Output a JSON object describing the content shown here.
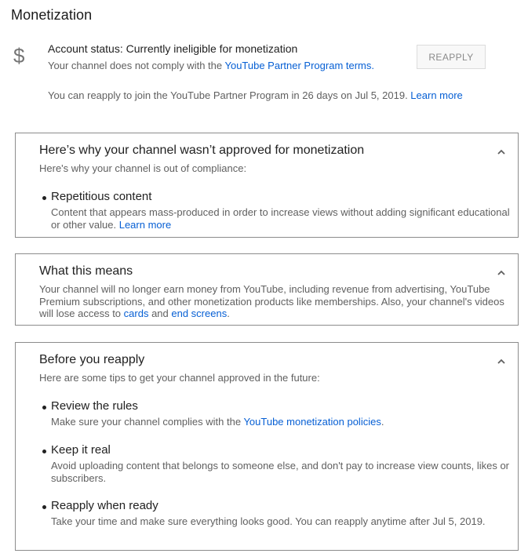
{
  "page": {
    "title": "Monetization"
  },
  "status": {
    "icon": "dollar-icon",
    "icon_glyph": "$",
    "title": "Account status: Currently ineligible for monetization",
    "desc_prefix": "Your channel does not comply with the ",
    "desc_link": "YouTube Partner Program terms.",
    "reapply_button": "REAPPLY",
    "note_prefix": "You can reapply to join the YouTube Partner Program in 26 days on Jul 5, 2019. ",
    "note_link": "Learn more"
  },
  "cards": {
    "why": {
      "title": "Here’s why your channel wasn’t approved for monetization",
      "subtitle": "Here's why your channel is out of compliance:",
      "items": [
        {
          "title": "Repetitious content",
          "desc": "Content that appears mass-produced in order to increase views without adding significant educational or other value. ",
          "link": "Learn more"
        }
      ]
    },
    "means": {
      "title": "What this means",
      "text_prefix": "Your channel will no longer earn money from YouTube, including revenue from advertising, YouTube Premium subscriptions, and other monetization products like memberships. Also, your channel's videos will lose access to ",
      "link_cards": "cards",
      "text_and": " and ",
      "link_end_screens": "end screens",
      "text_suffix": "."
    },
    "before": {
      "title": "Before you reapply",
      "subtitle": "Here are some tips to get your channel approved in the future:",
      "items": [
        {
          "title": "Review the rules",
          "desc_prefix": "Make sure your channel complies with the ",
          "link": "YouTube monetization policies",
          "desc_suffix": "."
        },
        {
          "title": "Keep it real",
          "desc": "Avoid uploading content that belongs to someone else, and don't pay to increase view counts, likes or subscribers."
        },
        {
          "title": "Reapply when ready",
          "desc": "Take your time and make sure everything looks good. You can reapply anytime after Jul 5, 2019."
        }
      ]
    }
  },
  "icons": {
    "collapse": "chevron-up-icon",
    "bullet": "bullet-dot"
  },
  "colors": {
    "link": "#065fd4",
    "secondary_text": "#606060",
    "primary_text": "#212121",
    "border": "#8c8c8c"
  }
}
